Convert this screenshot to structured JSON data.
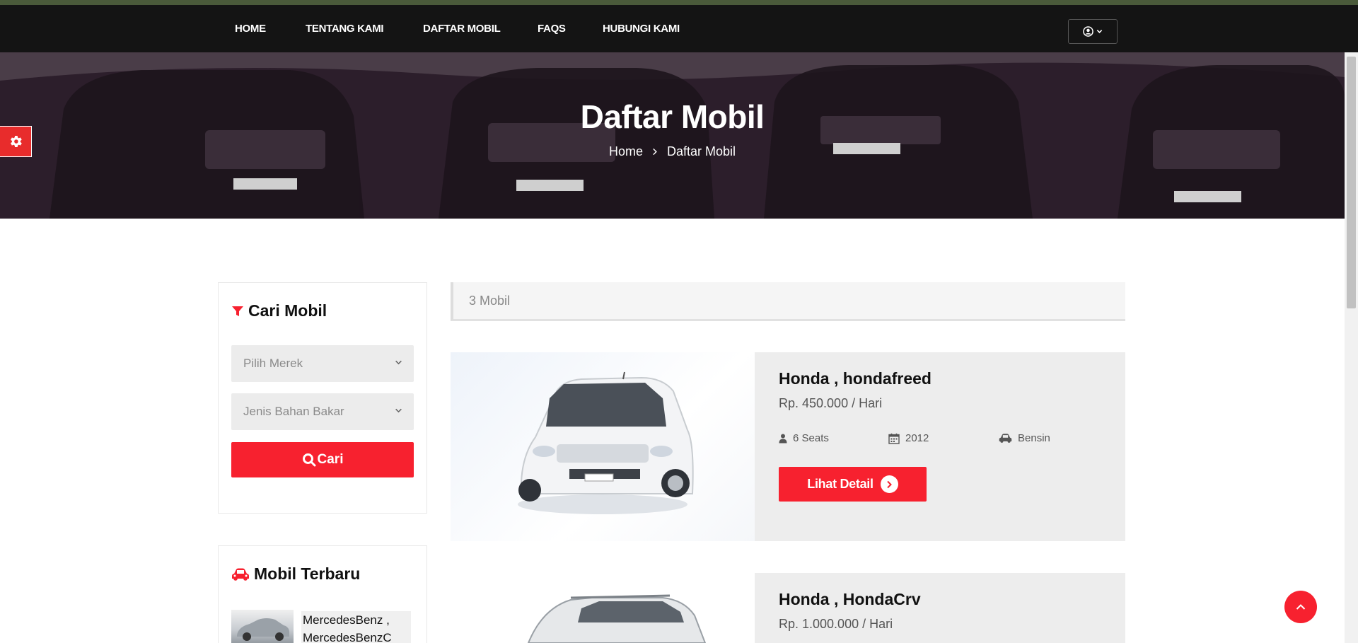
{
  "nav": {
    "items": [
      "HOME",
      "TENTANG KAMI",
      "DAFTAR MOBIL",
      "FAQS",
      "HUBUNGI KAMI"
    ],
    "user_icon": "user-circle-icon"
  },
  "hero": {
    "title": "Daftar Mobil",
    "breadcrumb_home": "Home",
    "breadcrumb_current": "Daftar Mobil"
  },
  "search": {
    "title": "Cari Mobil",
    "brand_select": "Pilih Merek",
    "fuel_select": "Jenis Bahan Bakar",
    "button": "Cari"
  },
  "recent": {
    "title": "Mobil Terbaru",
    "items": [
      {
        "name": "MercedesBenz , MercedesBenzC"
      }
    ]
  },
  "listing": {
    "count": "3 Mobil",
    "cars": [
      {
        "name": "Honda , hondafreed",
        "price": "Rp. 450.000 / Hari",
        "seats": "6 Seats",
        "year": "2012",
        "fuel": "Bensin",
        "button": "Lihat Detail"
      },
      {
        "name": "Honda , HondaCrv",
        "price": "Rp. 1.000.000 / Hari"
      }
    ]
  },
  "colors": {
    "accent": "#f7212f",
    "navbar": "#141414",
    "topline": "#4a5a3a"
  }
}
